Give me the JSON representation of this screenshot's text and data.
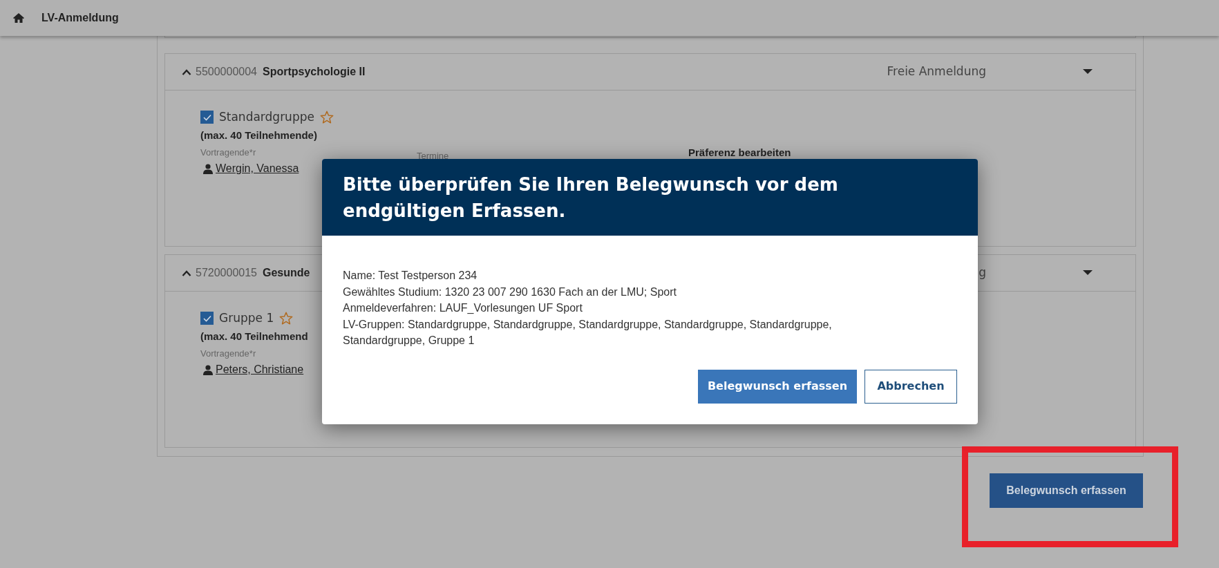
{
  "header": {
    "title": "LV-Anmeldung"
  },
  "courses": [
    {
      "number": "5500000004",
      "title": "Sportpsychologie II",
      "procedure": "Freie Anmeldung",
      "expanded": true,
      "group": {
        "label": "Standardgruppe",
        "checked": true,
        "favorite": false,
        "capacity": "(max. 40 Teilnehmende)",
        "lecturer_label": "Vortragende*r",
        "lecturer": "Wergin, Vanessa",
        "dates_label": "Termine",
        "preference_label": "Präferenz bearbeiten"
      }
    },
    {
      "number": "5720000015",
      "title": "Gesunde",
      "procedure": "g",
      "expanded": true,
      "group": {
        "label": "Gruppe 1",
        "checked": true,
        "favorite": false,
        "capacity": "(max. 40 Teilnehmend",
        "lecturer_label": "Vortragende*r",
        "lecturer": "Peters, Christiane"
      }
    }
  ],
  "dialog": {
    "title": "Bitte überprüfen Sie Ihren Belegwunsch vor dem endgültigen Erfassen.",
    "lines": [
      "Name: Test Testperson 234",
      "Gewähltes Studium: 1320 23 007 290 1630 Fach an der LMU; Sport",
      "Anmeldeverfahren: LAUF_Vorlesungen UF Sport",
      "LV-Gruppen: Standardgruppe, Standardgruppe, Standardgruppe, Standardgruppe, Standardgruppe, Standardgruppe, Gruppe 1"
    ],
    "buttons": [
      {
        "label": "Belegwunsch erfassen",
        "kind": "primary"
      },
      {
        "label": "Abbrechen",
        "kind": "secondary"
      }
    ]
  },
  "submit_button": {
    "label": "Belegwunsch erfassen",
    "highlighted": true
  }
}
